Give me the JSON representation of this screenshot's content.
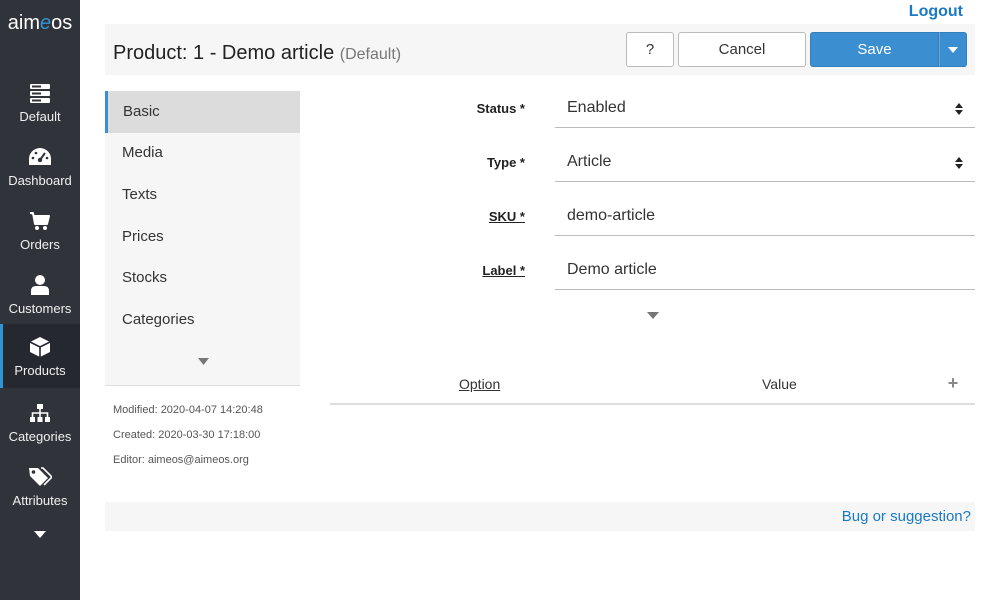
{
  "app": {
    "logo_prefix": "aim",
    "logo_e": "e",
    "logo_suffix": "os"
  },
  "sidebar": {
    "items": [
      {
        "label": "Default",
        "icon": "server-icon"
      },
      {
        "label": "Dashboard",
        "icon": "dashboard-gauge-icon"
      },
      {
        "label": "Orders",
        "icon": "shopping-cart-icon"
      },
      {
        "label": "Customers",
        "icon": "user-icon"
      },
      {
        "label": "Products",
        "icon": "cube-icon",
        "active": true
      },
      {
        "label": "Categories",
        "icon": "sitemap-icon"
      },
      {
        "label": "Attributes",
        "icon": "tags-icon"
      }
    ],
    "more_icon": "caret-down-icon"
  },
  "top": {
    "logout": "Logout"
  },
  "header": {
    "title": "Product: 1 - Demo article",
    "site": "(Default)",
    "help_label": "?",
    "cancel_label": "Cancel",
    "save_label": "Save"
  },
  "tabs": {
    "items": [
      "Basic",
      "Media",
      "Texts",
      "Prices",
      "Stocks",
      "Categories"
    ],
    "active": "Basic"
  },
  "meta": {
    "modified": "Modified: 2020-04-07 14:20:48",
    "created": "Created: 2020-03-30 17:18:00",
    "editor": "Editor: aimeos@aimeos.org"
  },
  "form": {
    "status": {
      "label": "Status *",
      "value": "Enabled"
    },
    "type": {
      "label": "Type *",
      "value": "Article"
    },
    "sku": {
      "label": "SKU *",
      "value": "demo-article"
    },
    "label": {
      "label": "Label *",
      "value": "Demo article"
    }
  },
  "config_table": {
    "option": "Option",
    "value": "Value",
    "add": "+"
  },
  "footer": {
    "bug_link": "Bug or suggestion?"
  },
  "colors": {
    "sidebar_bg": "#30333a",
    "accent": "#3b8fd0",
    "link": "#1b79c5"
  }
}
